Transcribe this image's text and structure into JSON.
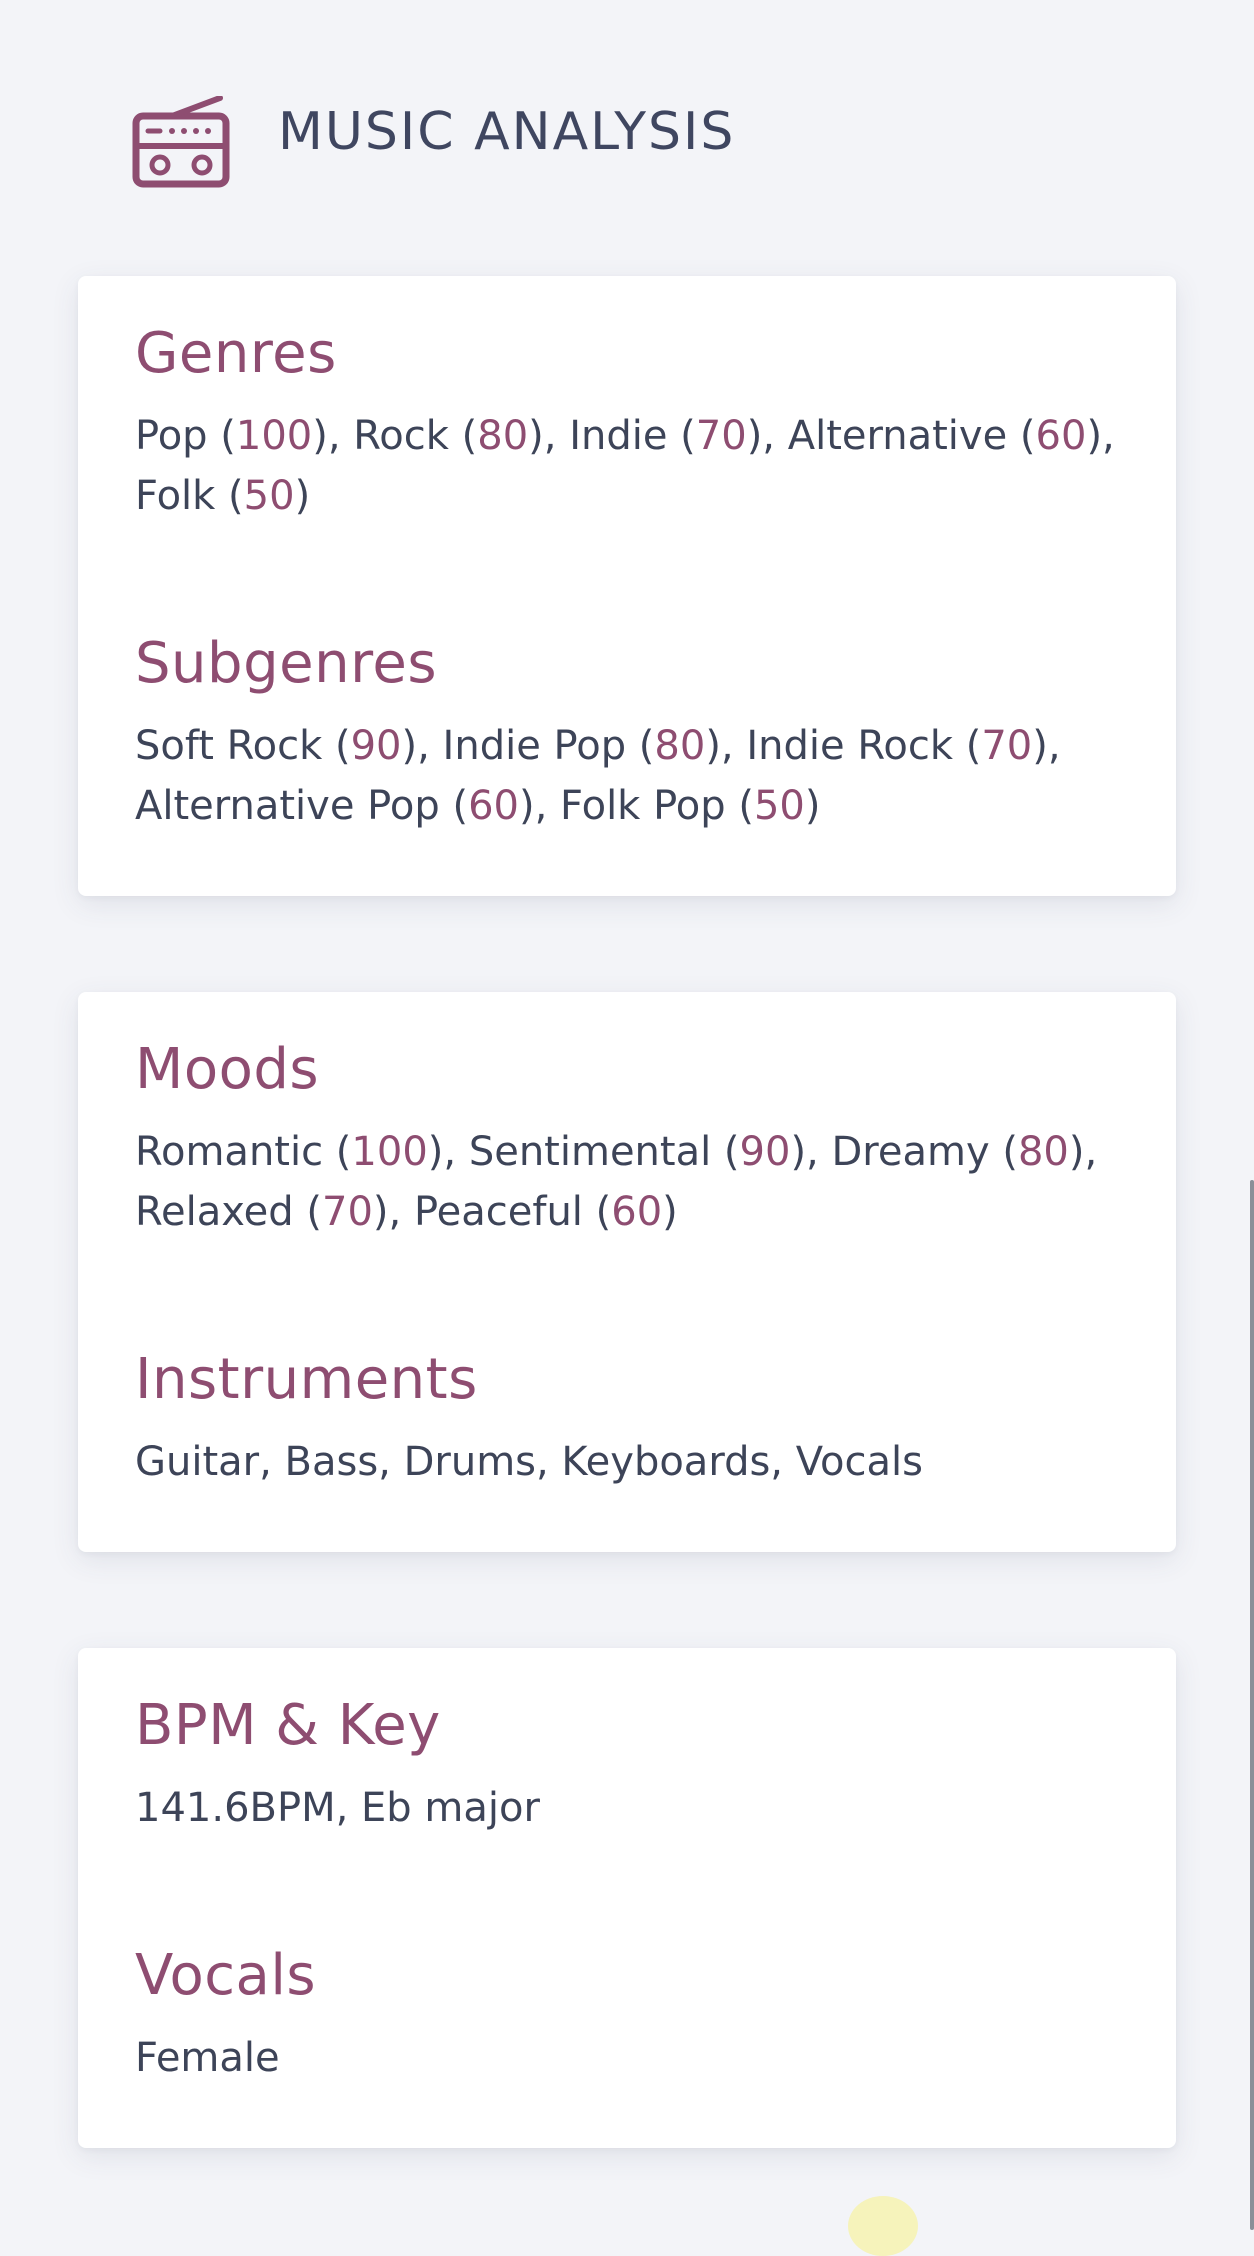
{
  "header": {
    "title": "MUSIC ANALYSIS",
    "icon": "radio-icon"
  },
  "colors": {
    "accent": "#8e4d71",
    "text": "#3d4458",
    "background": "#f3f4f8",
    "card": "#ffffff"
  },
  "cards": [
    {
      "sections": [
        {
          "title": "Genres",
          "items": [
            {
              "name": "Pop",
              "score": "100"
            },
            {
              "name": "Rock",
              "score": "80"
            },
            {
              "name": "Indie",
              "score": "70"
            },
            {
              "name": "Alternative",
              "score": "60"
            },
            {
              "name": "Folk",
              "score": "50"
            }
          ]
        },
        {
          "title": "Subgenres",
          "items": [
            {
              "name": "Soft Rock",
              "score": "90"
            },
            {
              "name": "Indie Pop",
              "score": "80"
            },
            {
              "name": "Indie Rock",
              "score": "70"
            },
            {
              "name": "Alternative Pop",
              "score": "60"
            },
            {
              "name": "Folk Pop",
              "score": "50"
            }
          ]
        }
      ]
    },
    {
      "sections": [
        {
          "title": "Moods",
          "items": [
            {
              "name": "Romantic",
              "score": "100"
            },
            {
              "name": "Sentimental",
              "score": "90"
            },
            {
              "name": "Dreamy",
              "score": "80"
            },
            {
              "name": "Relaxed",
              "score": "70"
            },
            {
              "name": "Peaceful",
              "score": "60"
            }
          ]
        },
        {
          "title": "Instruments",
          "text": "Guitar, Bass, Drums, Keyboards, Vocals"
        }
      ]
    },
    {
      "sections": [
        {
          "title": "BPM & Key",
          "text": "141.6BPM, Eb major"
        },
        {
          "title": "Vocals",
          "text": "Female"
        }
      ]
    }
  ]
}
